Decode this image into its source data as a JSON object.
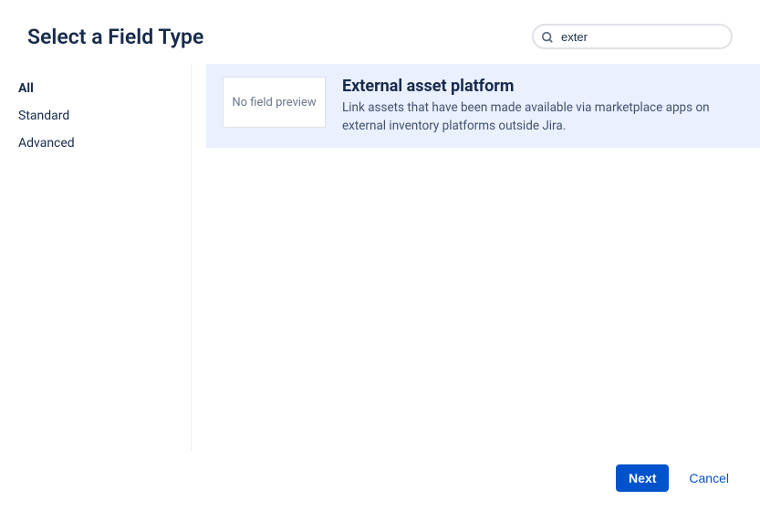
{
  "header": {
    "title": "Select a Field Type"
  },
  "search": {
    "value": "exter"
  },
  "sidebar": {
    "items": [
      {
        "label": "All",
        "active": true
      },
      {
        "label": "Standard",
        "active": false
      },
      {
        "label": "Advanced",
        "active": false
      }
    ]
  },
  "main": {
    "preview_text": "No field preview",
    "field_title": "External asset platform",
    "field_desc": "Link assets that have been made available via marketplace apps on external inventory platforms outside Jira."
  },
  "footer": {
    "next_label": "Next",
    "cancel_label": "Cancel"
  }
}
